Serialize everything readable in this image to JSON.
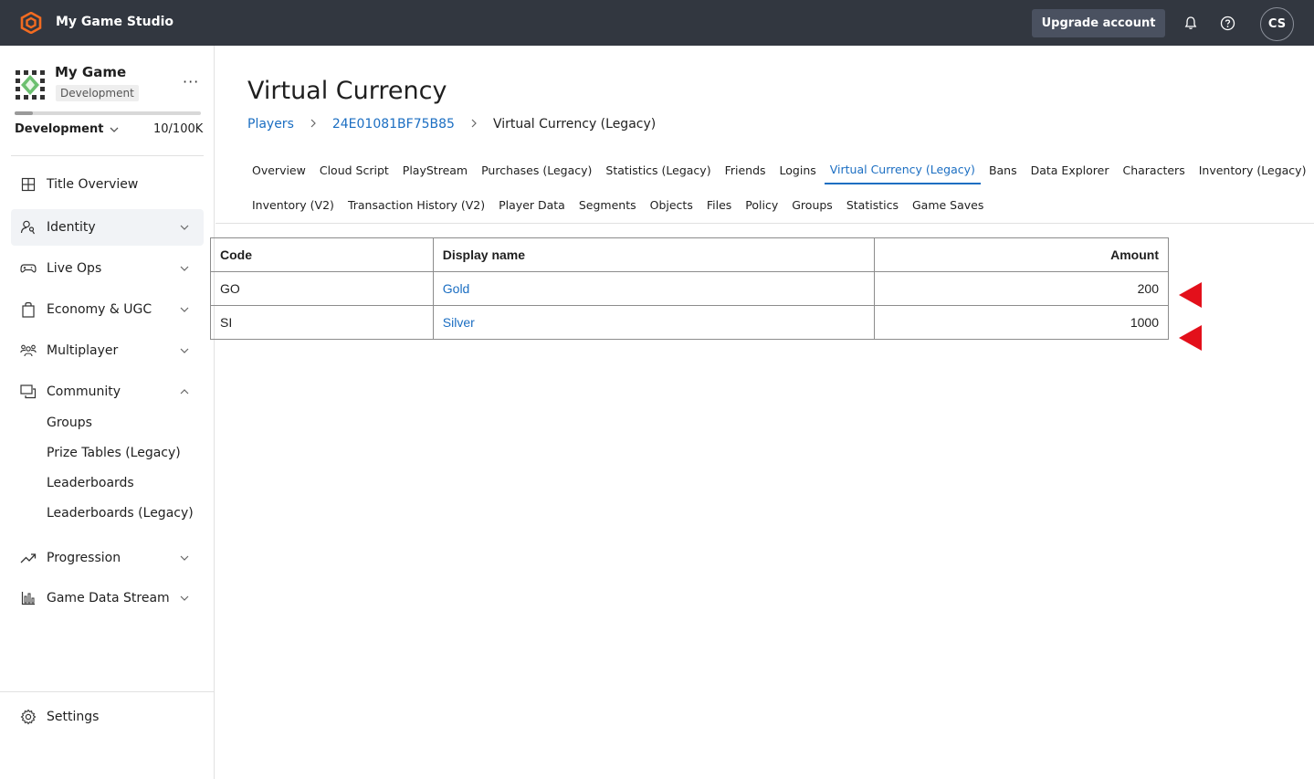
{
  "topbar": {
    "studio_name": "My Game Studio",
    "upgrade_label": "Upgrade account",
    "avatar_initials": "CS"
  },
  "sidebar": {
    "game_name": "My Game",
    "environment_badge": "Development",
    "environment_select": "Development",
    "usage": "10/100K",
    "usage_fraction": 0.1,
    "nav": {
      "title_overview": "Title Overview",
      "identity": "Identity",
      "live_ops": "Live Ops",
      "economy": "Economy & UGC",
      "multiplayer": "Multiplayer",
      "community": "Community",
      "community_sub": [
        "Groups",
        "Prize Tables (Legacy)",
        "Leaderboards",
        "Leaderboards (Legacy)"
      ],
      "progression": "Progression",
      "game_data_stream": "Game Data Stream",
      "settings": "Settings"
    }
  },
  "main": {
    "title": "Virtual Currency",
    "breadcrumb": [
      "Players",
      "24E01081BF75B85",
      "Virtual Currency (Legacy)"
    ],
    "tabs_row1": [
      "Overview",
      "Cloud Script",
      "PlayStream",
      "Purchases (Legacy)",
      "Statistics (Legacy)",
      "Friends",
      "Logins",
      "Virtual Currency (Legacy)",
      "Bans",
      "Data Explorer",
      "Characters",
      "Inventory (Legacy)"
    ],
    "tabs_row2": [
      "Inventory (V2)",
      "Transaction History (V2)",
      "Player Data",
      "Segments",
      "Objects",
      "Files",
      "Policy",
      "Groups",
      "Statistics",
      "Game Saves"
    ],
    "active_tab": "Virtual Currency (Legacy)",
    "table": {
      "headers": [
        "Code",
        "Display name",
        "Amount"
      ],
      "rows": [
        [
          "GO",
          "Gold",
          "200"
        ],
        [
          "SI",
          "Silver",
          "1000"
        ]
      ]
    },
    "marker_color": "#e3101b"
  },
  "colors": {
    "topbar": "#323740",
    "accent": "#1b6ec2",
    "brand": "#f26b21"
  }
}
